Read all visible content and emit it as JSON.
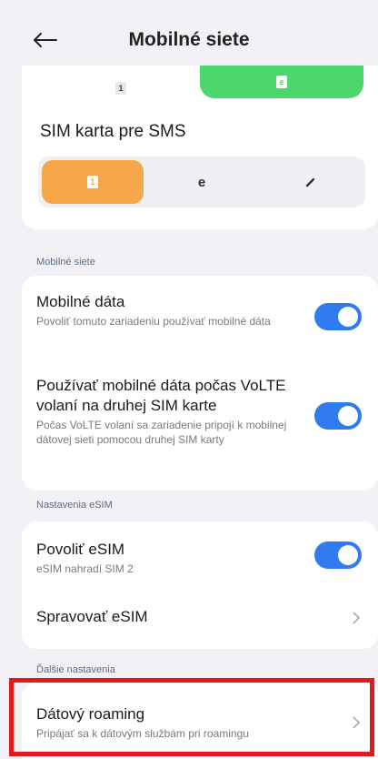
{
  "header": {
    "title": "Mobilné siete"
  },
  "sim_top": {
    "sim1_badge": "1",
    "sim2_badge": "e"
  },
  "sms_card": {
    "title": "SIM karta pre SMS",
    "options": [
      {
        "badge": "1",
        "selected": true
      },
      {
        "label": "e",
        "selected": false
      },
      {
        "badge": "pencil",
        "selected": false
      }
    ]
  },
  "mobile_networks": {
    "section_label": "Mobilné siete",
    "mobile_data": {
      "title": "Mobilné dáta",
      "subtitle": "Povoliť tomuto zariadeniu používať mobilné dáta",
      "enabled": true
    },
    "volte_data": {
      "title": "Používať mobilné dáta počas VoLTE volaní na druhej SIM karte",
      "subtitle": "Počas VoLTE volaní sa zariadenie pripojí k mobilnej dátovej sieti pomocou druhej SIM karty",
      "enabled": true
    }
  },
  "esim": {
    "section_label": "Nastavenia eSIM",
    "allow": {
      "title": "Povoliť eSIM",
      "subtitle": "eSIM nahradí SIM 2",
      "enabled": true
    },
    "manage": {
      "title": "Spravovať eSIM"
    }
  },
  "more": {
    "section_label": "Ďalšie nastavenia",
    "roaming": {
      "title": "Dátový roaming",
      "subtitle": "Pripájať sa k dátovým službám pri roamingu"
    }
  },
  "colors": {
    "accent_blue": "#2f7bf0",
    "sim_green": "#4cd66e",
    "sim_orange": "#f5a74a",
    "highlight_red": "#e01b1b"
  }
}
